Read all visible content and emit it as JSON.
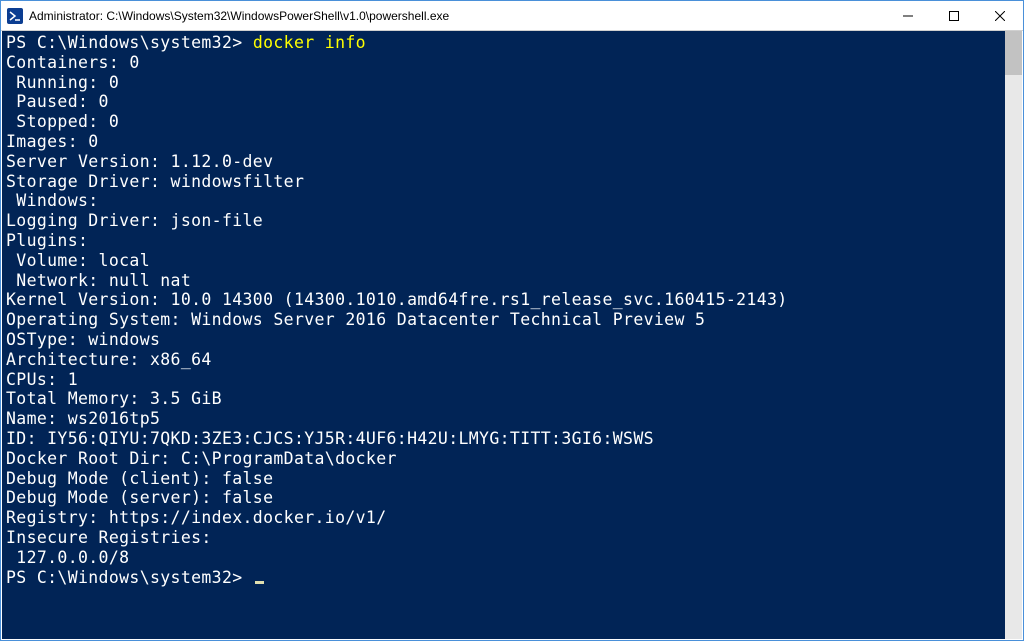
{
  "window": {
    "title": "Administrator: C:\\Windows\\System32\\WindowsPowerShell\\v1.0\\powershell.exe"
  },
  "prompt1": "PS C:\\Windows\\system32> ",
  "command1": "docker info",
  "output": {
    "l1": "Containers: 0",
    "l2": " Running: 0",
    "l3": " Paused: 0",
    "l4": " Stopped: 0",
    "l5": "Images: 0",
    "l6": "Server Version: 1.12.0-dev",
    "l7": "Storage Driver: windowsfilter",
    "l8": " Windows:",
    "l9": "Logging Driver: json-file",
    "l10": "Plugins:",
    "l11": " Volume: local",
    "l12": " Network: null nat",
    "l13": "Kernel Version: 10.0 14300 (14300.1010.amd64fre.rs1_release_svc.160415-2143)",
    "l14": "Operating System: Windows Server 2016 Datacenter Technical Preview 5",
    "l15": "OSType: windows",
    "l16": "Architecture: x86_64",
    "l17": "CPUs: 1",
    "l18": "Total Memory: 3.5 GiB",
    "l19": "Name: ws2016tp5",
    "l20": "ID: IY56:QIYU:7QKD:3ZE3:CJCS:YJ5R:4UF6:H42U:LMYG:TITT:3GI6:WSWS",
    "l21": "Docker Root Dir: C:\\ProgramData\\docker",
    "l22": "Debug Mode (client): false",
    "l23": "Debug Mode (server): false",
    "l24": "Registry: https://index.docker.io/v1/",
    "l25": "Insecure Registries:",
    "l26": " 127.0.0.0/8"
  },
  "prompt2": "PS C:\\Windows\\system32> "
}
